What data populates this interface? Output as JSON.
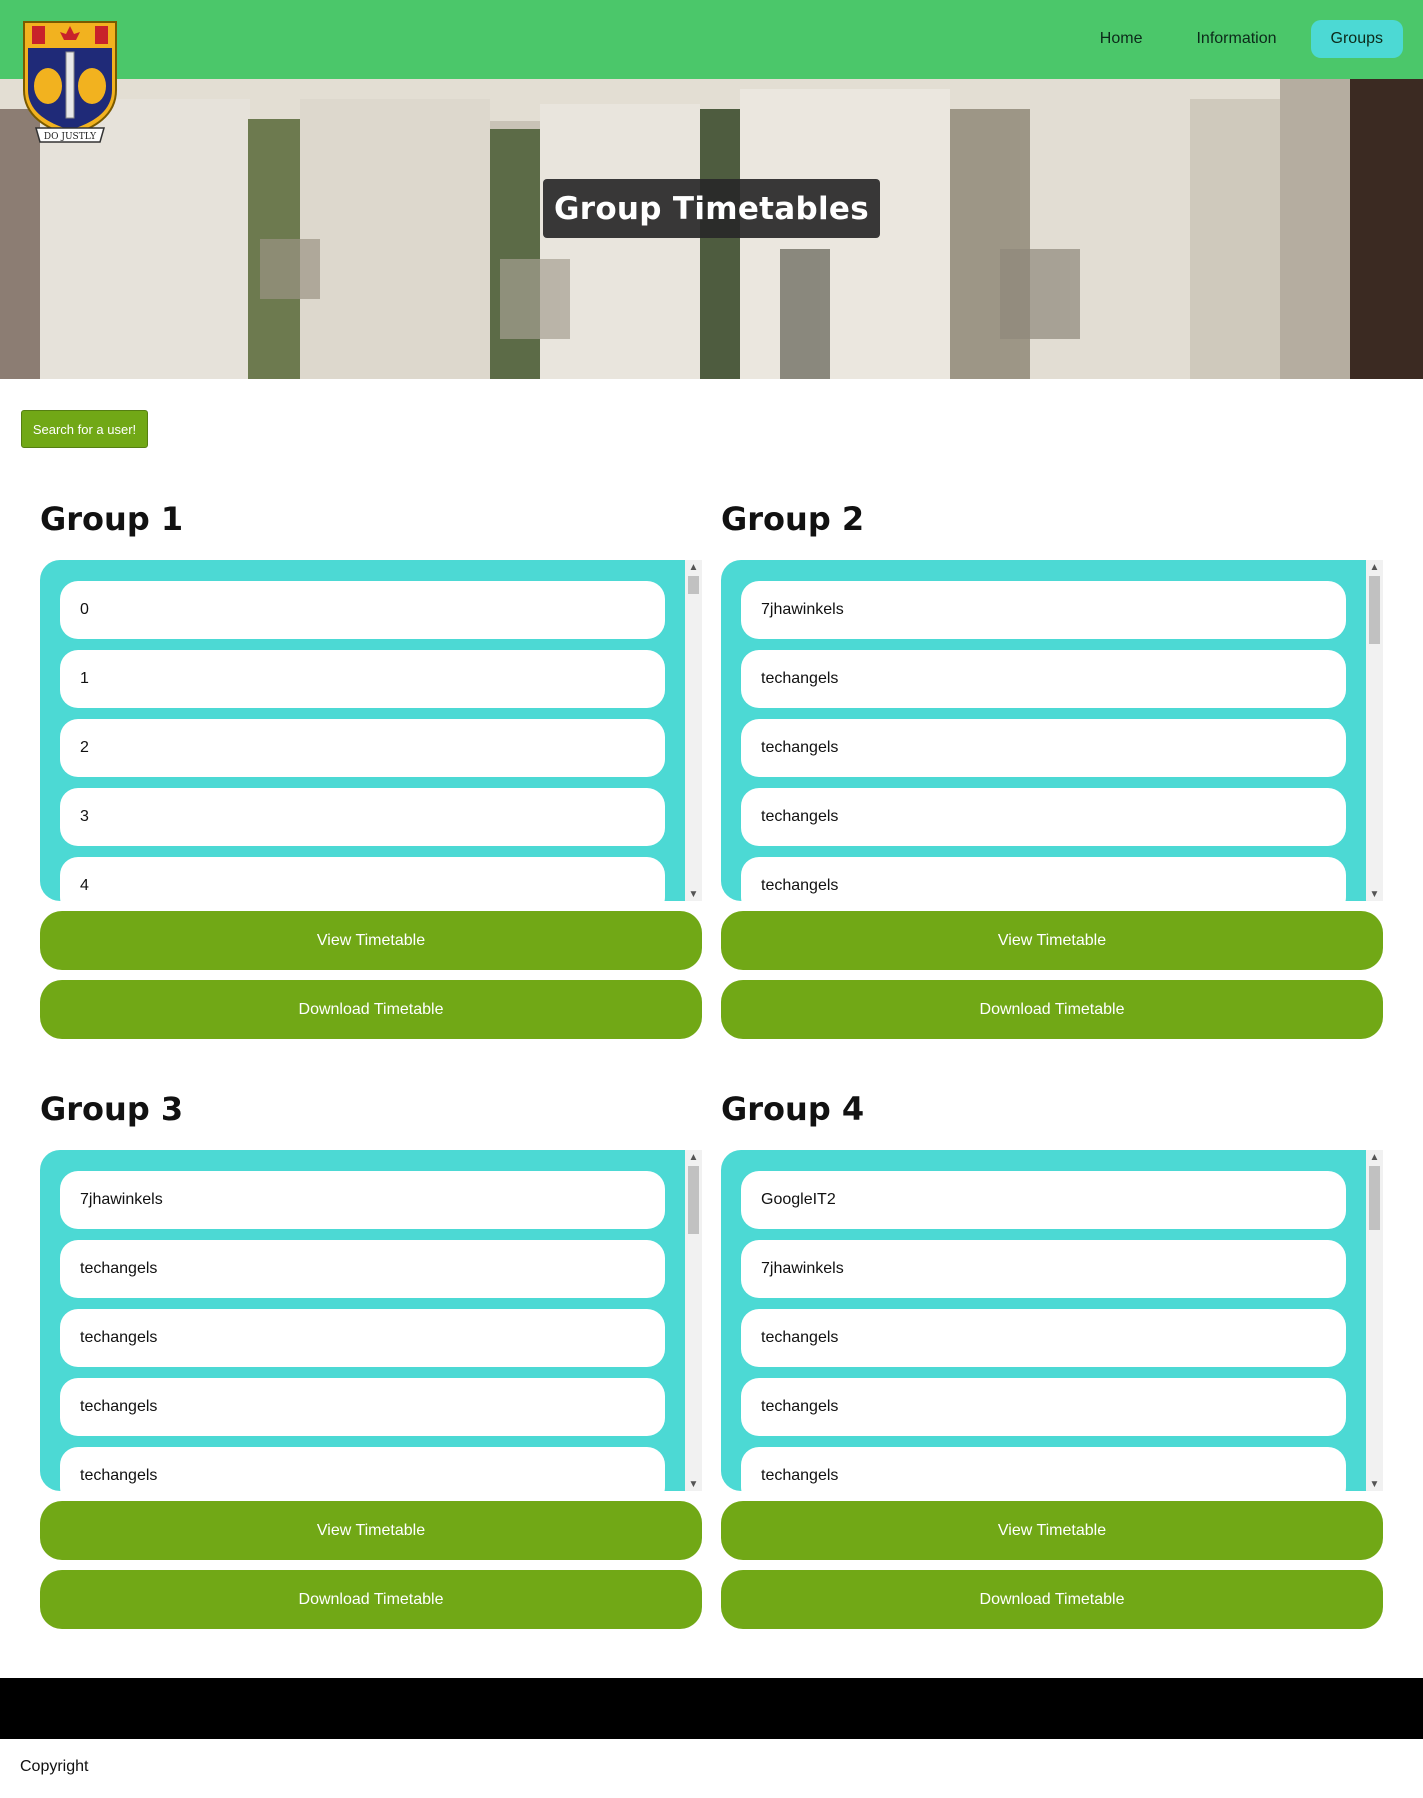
{
  "header": {
    "logo_icon": "school-crest-icon",
    "logo_motto": "DO JUSTLY",
    "nav": [
      {
        "label": "Home",
        "active": false
      },
      {
        "label": "Information",
        "active": false
      },
      {
        "label": "Groups",
        "active": true
      }
    ],
    "bar_color": "#4bc76a",
    "active_color": "#4cd9d4"
  },
  "hero": {
    "title": "Group Timetables"
  },
  "search_button": "Search for a user!",
  "groups": [
    {
      "title": "Group 1",
      "members": [
        "0",
        "1",
        "2",
        "3",
        "4"
      ],
      "view_label": "View Timetable",
      "download_label": "Download Timetable"
    },
    {
      "title": "Group 2",
      "members": [
        "7jhawinkels",
        "techangels",
        "techangels",
        "techangels",
        "techangels"
      ],
      "view_label": "View Timetable",
      "download_label": "Download Timetable"
    },
    {
      "title": "Group 3",
      "members": [
        "7jhawinkels",
        "techangels",
        "techangels",
        "techangels",
        "techangels"
      ],
      "view_label": "View Timetable",
      "download_label": "Download Timetable"
    },
    {
      "title": "Group 4",
      "members": [
        "GoogleIT2",
        "7jhawinkels",
        "techangels",
        "techangels",
        "techangels"
      ],
      "view_label": "View Timetable",
      "download_label": "Download Timetable"
    }
  ],
  "colors": {
    "list_bg": "#4cd9d4",
    "button": "#71a816",
    "footer": "#000000"
  },
  "footer": {
    "copyright": "Copyright"
  }
}
